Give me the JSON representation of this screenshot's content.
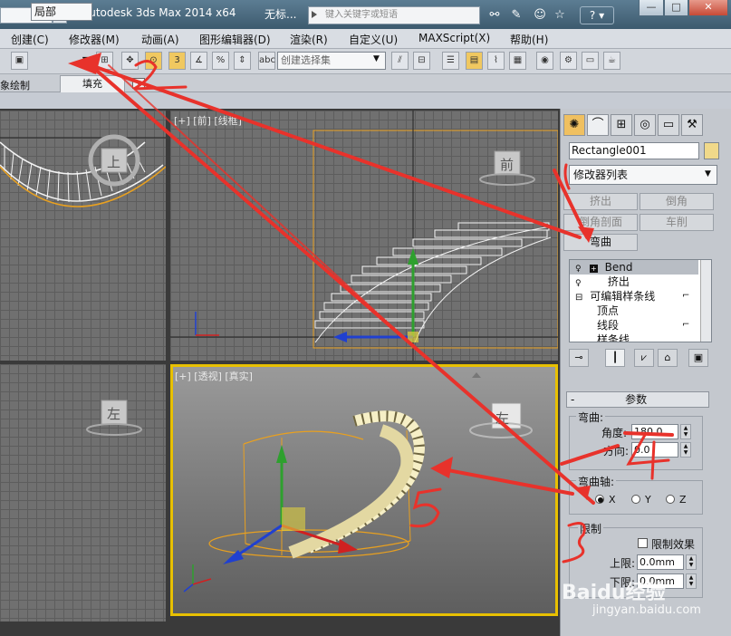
{
  "title_bar": {
    "app_title": "Autodesk 3ds Max  2014 x64",
    "doc_title": "无标...",
    "search_placeholder": "键入关键字或短语",
    "help": "?"
  },
  "window_buttons": {
    "minimize": "—",
    "maximize": "□",
    "close": "✕"
  },
  "menu": [
    "创建(C)",
    "修改器(M)",
    "动画(A)",
    "图形编辑器(D)",
    "渲染(R)",
    "自定义(U)",
    "MAXScript(X)",
    "帮助(H)"
  ],
  "toolbar": {
    "ref_coord": "局部",
    "named_selection_placeholder": "创建选择集",
    "snap_label": "3",
    "angle_snap_label": "%"
  },
  "ribbon": {
    "left_label": "象绘制",
    "tab": "填充"
  },
  "viewports": {
    "top_left": {
      "viewcube": "上"
    },
    "top_right": {
      "label": "[+] [前] [线框]",
      "viewcube": "前"
    },
    "bottom_left": {
      "viewcube": "左"
    },
    "bottom_right": {
      "label": "[+] [透视] [真实]",
      "viewcube": "左"
    }
  },
  "command_panel": {
    "object_name": "Rectangle001",
    "modifier_list": "修改器列表",
    "modifier_buttons": [
      "挤出",
      "倒角",
      "倒角剖面",
      "车削",
      "弯曲"
    ],
    "stack": [
      {
        "label": "Bend",
        "indent": 0,
        "selected": true
      },
      {
        "label": "挤出",
        "indent": 1,
        "selected": false
      },
      {
        "label": "可编辑样条线",
        "indent": 0,
        "selected": false
      },
      {
        "label": "顶点",
        "indent": 2,
        "selected": false
      },
      {
        "label": "线段",
        "indent": 2,
        "selected": false
      },
      {
        "label": "样条线",
        "indent": 2,
        "selected": false
      }
    ],
    "rollout_title": "参数",
    "bend_group": "弯曲:",
    "angle_label": "角度:",
    "angle_value": "180.0",
    "direction_label": "方向:",
    "direction_value": "0.0",
    "axis_group": "弯曲轴:",
    "axis_x": "X",
    "axis_y": "Y",
    "axis_z": "Z",
    "selected_axis": "X",
    "limit_group": "限制",
    "limit_effect": "限制效果",
    "upper_label": "上限:",
    "upper_value": "0.0mm",
    "lower_label": "下限:",
    "lower_value": "0.0mm"
  },
  "annotations": {
    "num2": "2",
    "num3": "3",
    "num4": "4",
    "num5": "5",
    "color": "#e8322b"
  },
  "watermark": {
    "text": "Baidu经验",
    "url": "jingyan.baidu.com"
  }
}
